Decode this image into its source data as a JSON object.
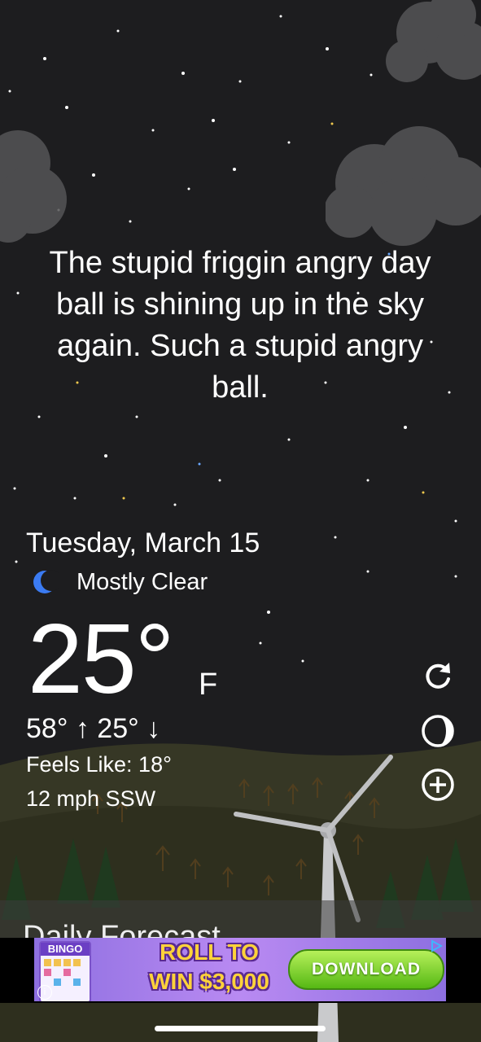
{
  "message": {
    "line1": "The stupid friggin angry day",
    "line2": "ball is shining up in the sky",
    "line3": "again. Such a stupid angry",
    "line4": "ball."
  },
  "weather": {
    "date": "Tuesday, March 15",
    "condition_icon": "crescent-moon-icon",
    "condition": "Mostly Clear",
    "temperature": "25°",
    "unit": "F",
    "high_low": "58° ↑ 25° ↓",
    "feels_like": "Feels Like: 18°",
    "wind": "12 mph SSW"
  },
  "actions": {
    "refresh_icon": "refresh-icon",
    "theme_icon": "moon-phase-icon",
    "add_icon": "add-circle-icon"
  },
  "daily": {
    "title": "Daily Forecast"
  },
  "ad": {
    "card_title": "BINGO",
    "line1": "ROLL TO",
    "line2": "WIN $3,000",
    "button": "DOWNLOAD",
    "info": "i"
  },
  "colors": {
    "background": "#1d1d1f",
    "moon_accent": "#3b7bf2",
    "download_green": "#56b814",
    "ad_purple": "#8d6fe0",
    "ad_yellow": "#ffd23a"
  }
}
